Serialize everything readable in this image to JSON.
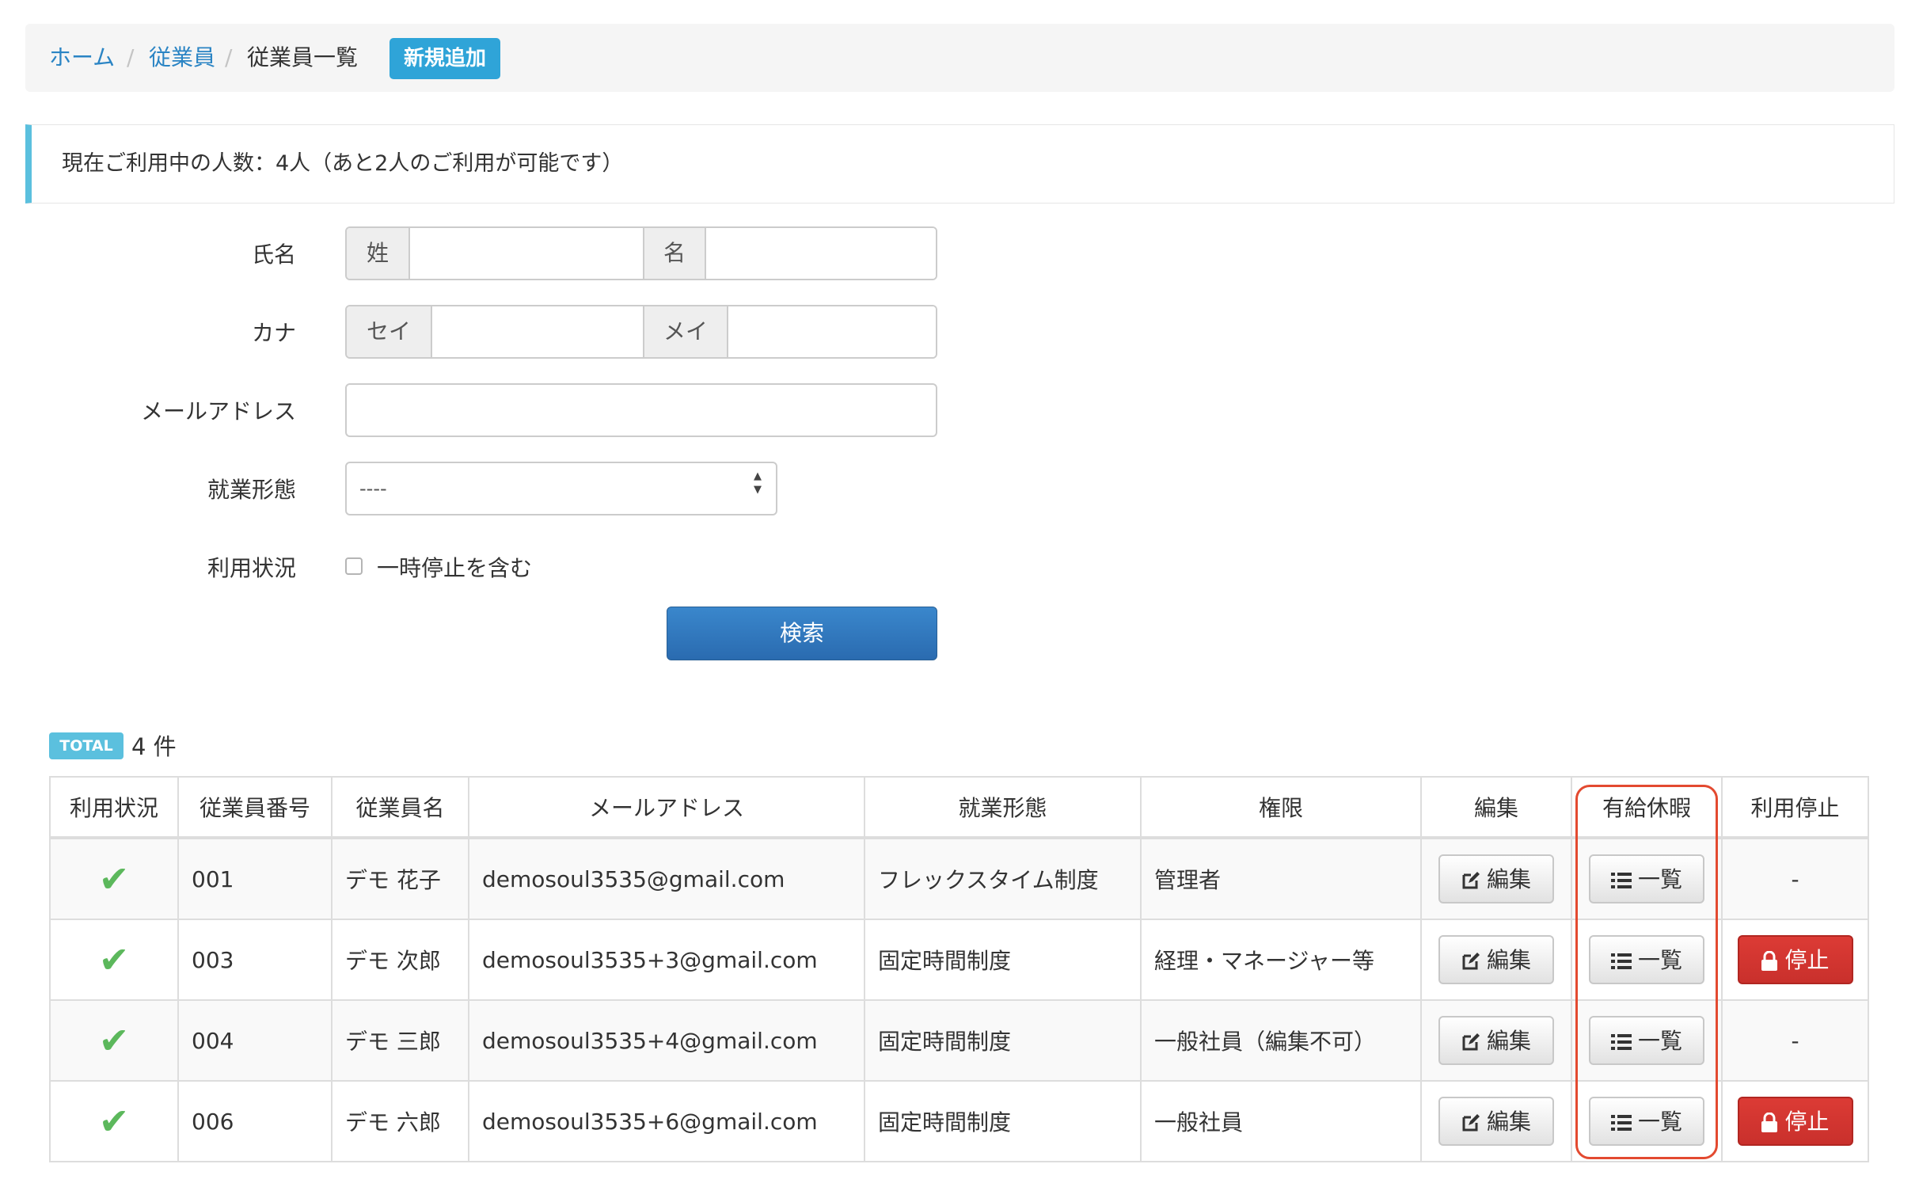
{
  "breadcrumb": {
    "home": "ホーム",
    "separator": "/",
    "employees": "従業員",
    "current": "従業員一覧",
    "new_button": "新規追加"
  },
  "info": {
    "message": "現在ご利用中の人数：4人（あと2人のご利用が可能です）"
  },
  "form": {
    "name_label": "氏名",
    "last_name_addon": "姓",
    "first_name_addon": "名",
    "last_name_value": "",
    "first_name_value": "",
    "kana_label": "カナ",
    "last_kana_addon": "セイ",
    "first_kana_addon": "メイ",
    "last_kana_value": "",
    "first_kana_value": "",
    "email_label": "メールアドレス",
    "email_value": "",
    "employment_label": "就業形態",
    "employment_selected": "----",
    "status_label": "利用状況",
    "include_suspended_label": "一時停止を含む",
    "include_suspended_checked": false,
    "search_button": "検索"
  },
  "total": {
    "badge": "TOTAL",
    "count_text": "4 件"
  },
  "table": {
    "headers": [
      "利用状況",
      "従業員番号",
      "従業員名",
      "メールアドレス",
      "就業形態",
      "権限",
      "編集",
      "有給休暇",
      "利用停止"
    ],
    "rows": [
      {
        "status_icon": "✔",
        "number": "001",
        "name": "デモ 花子",
        "email": "demosoul3535@gmail.com",
        "employment": "フレックスタイム制度",
        "role": "管理者",
        "edit": "編集",
        "leave": "一覧",
        "suspend": "-"
      },
      {
        "status_icon": "✔",
        "number": "003",
        "name": "デモ 次郎",
        "email": "demosoul3535+3@gmail.com",
        "employment": "固定時間制度",
        "role": "経理・マネージャー等",
        "edit": "編集",
        "leave": "一覧",
        "suspend": "停止"
      },
      {
        "status_icon": "✔",
        "number": "004",
        "name": "デモ 三郎",
        "email": "demosoul3535+4@gmail.com",
        "employment": "固定時間制度",
        "role": "一般社員（編集不可）",
        "edit": "編集",
        "leave": "一覧",
        "suspend": "-"
      },
      {
        "status_icon": "✔",
        "number": "006",
        "name": "デモ 六郎",
        "email": "demosoul3535+6@gmail.com",
        "employment": "固定時間制度",
        "role": "一般社員",
        "edit": "編集",
        "leave": "一覧",
        "suspend": "停止"
      }
    ]
  },
  "icons": {
    "status": "check-icon",
    "edit": "edit-icon",
    "list": "list-icon",
    "suspend": "lock-icon"
  },
  "colors": {
    "link": "#2a84c4",
    "new_button": "#2fa4d8",
    "info_border": "#5bc0de",
    "search_button": "#3a87cc",
    "status_check": "#5cb85c",
    "suspend_button": "#d9534f",
    "highlight": "#e34a30"
  }
}
